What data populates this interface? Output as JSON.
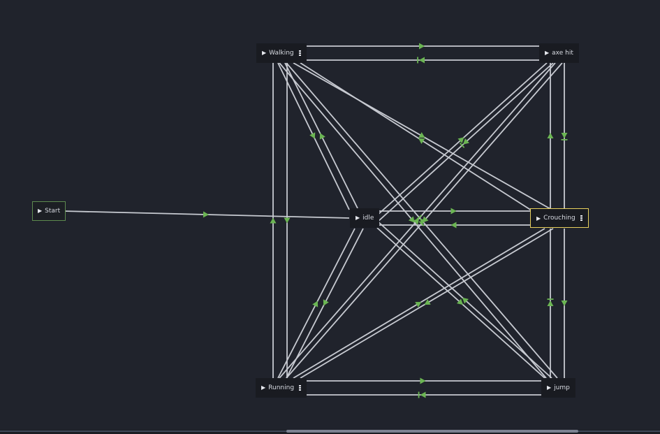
{
  "graph": {
    "nodes": {
      "start": {
        "label": "Start"
      },
      "walking": {
        "label": "Walking",
        "more": true
      },
      "axe_hit": {
        "label": "axe hit"
      },
      "idle": {
        "label": "idle"
      },
      "crouching": {
        "label": "Crouching",
        "more": true,
        "selected": true
      },
      "running": {
        "label": "Running",
        "more": true
      },
      "jump": {
        "label": "jump"
      }
    }
  },
  "colors": {
    "background": "#20232c",
    "edge": "#c7cad1",
    "arrow": "#6bb553",
    "node": "#191b21",
    "start_border": "#5d8a4f",
    "selected_border": "#e7cf5c"
  }
}
